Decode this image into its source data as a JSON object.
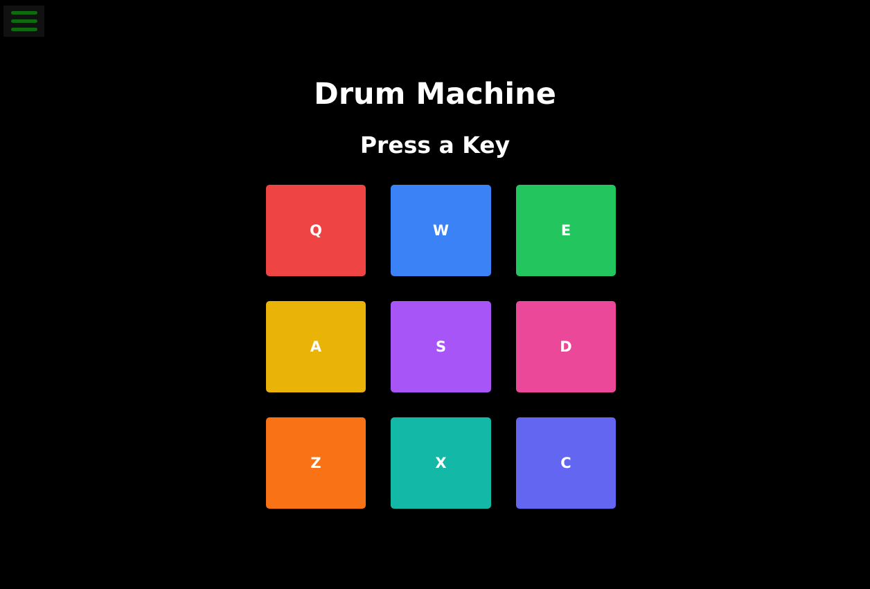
{
  "menu": {
    "icon": "hamburger-menu-icon",
    "bar_color": "#0f6b0f",
    "background": "#111111"
  },
  "header": {
    "title": "Drum Machine",
    "display": "Press a Key"
  },
  "pads": [
    {
      "key": "Q",
      "color": "#ef4444"
    },
    {
      "key": "W",
      "color": "#3b82f6"
    },
    {
      "key": "E",
      "color": "#22c55e"
    },
    {
      "key": "A",
      "color": "#eab308"
    },
    {
      "key": "S",
      "color": "#a855f7"
    },
    {
      "key": "D",
      "color": "#ec4899"
    },
    {
      "key": "Z",
      "color": "#f97316"
    },
    {
      "key": "X",
      "color": "#14b8a6"
    },
    {
      "key": "C",
      "color": "#6366f1"
    }
  ]
}
